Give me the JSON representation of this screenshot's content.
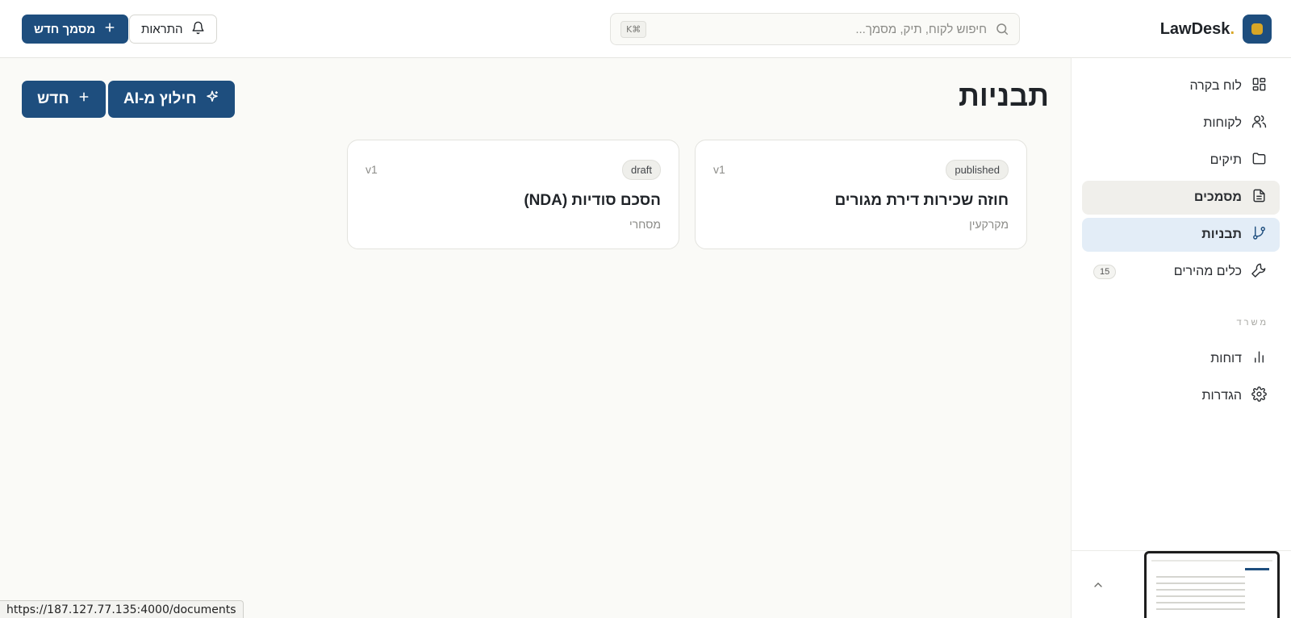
{
  "header": {
    "brand_name": "LawDesk",
    "brand_dot": ".",
    "search_placeholder": "חיפוש לקוח, תיק, מסמך...",
    "search_shortcut": "K⌘",
    "notifications_label": "התראות",
    "new_document_label": "מסמך חדש"
  },
  "sidebar": {
    "items": [
      {
        "label": "לוח בקרה",
        "icon": "dashboard-icon"
      },
      {
        "label": "לקוחות",
        "icon": "users-icon"
      },
      {
        "label": "תיקים",
        "icon": "folder-icon"
      },
      {
        "label": "מסמכים",
        "icon": "document-icon"
      },
      {
        "label": "תבניות",
        "icon": "git-branch-icon"
      },
      {
        "label": "כלים מהירים",
        "icon": "wrench-icon",
        "badge": "15"
      }
    ],
    "section_label": "משרד",
    "office_items": [
      {
        "label": "דוחות",
        "icon": "bar-chart-icon"
      },
      {
        "label": "הגדרות",
        "icon": "gear-icon"
      }
    ]
  },
  "main": {
    "title": "תבניות",
    "ai_extract_label": "חילוץ מ-AI",
    "new_label": "חדש",
    "templates": [
      {
        "status": "published",
        "version": "v1",
        "title": "חוזה שכירות דירת מגורים",
        "category": "מקרקעין"
      },
      {
        "status": "draft",
        "version": "v1",
        "title": "הסכם סודיות (NDA)",
        "category": "מסחרי"
      }
    ]
  },
  "status_bar": {
    "url": "https://187.127.77.135:4000/documents"
  },
  "colors": {
    "primary": "#1e4e7e",
    "brand_accent": "#d8a626",
    "active_nav": "#e3edf7",
    "background": "#fafaf7"
  }
}
